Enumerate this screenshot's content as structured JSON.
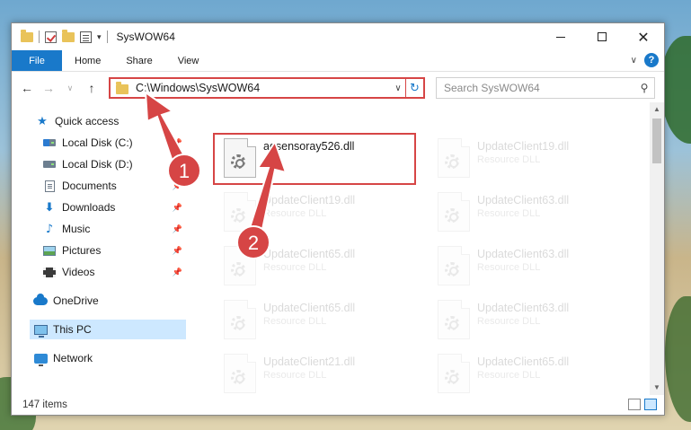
{
  "window": {
    "title": "SysWOW64"
  },
  "ribbon": {
    "tabs": [
      "File",
      "Home",
      "Share",
      "View"
    ],
    "help_label": "?"
  },
  "address": {
    "path": "C:\\Windows\\SysWOW64"
  },
  "search": {
    "placeholder": "Search SysWOW64"
  },
  "sidebar": {
    "items": [
      {
        "label": "Quick access",
        "icon": "star-icon"
      },
      {
        "label": "Local Disk (C:)",
        "icon": "disk-icon",
        "pinned": true
      },
      {
        "label": "Local Disk (D:)",
        "icon": "disk-icon"
      },
      {
        "label": "Documents",
        "icon": "documents-icon",
        "pinned": true
      },
      {
        "label": "Downloads",
        "icon": "downloads-icon",
        "pinned": true
      },
      {
        "label": "Music",
        "icon": "music-icon",
        "pinned": true
      },
      {
        "label": "Pictures",
        "icon": "pictures-icon",
        "pinned": true
      },
      {
        "label": "Videos",
        "icon": "videos-icon",
        "pinned": true
      },
      {
        "label": "OneDrive",
        "icon": "onedrive-icon"
      },
      {
        "label": "This PC",
        "icon": "this-pc-icon",
        "selected": true
      },
      {
        "label": "Network",
        "icon": "network-icon"
      }
    ]
  },
  "files": [
    {
      "name": "adsensoray526.dll",
      "type": "",
      "highlighted": true
    },
    {
      "name": "UpdateClient19.dll",
      "type": "Resource DLL"
    },
    {
      "name": "UpdateClient19.dll",
      "type": "Resource DLL"
    },
    {
      "name": "UpdateClient63.dll",
      "type": "Resource DLL"
    },
    {
      "name": "UpdateClient65.dll",
      "type": "Resource DLL"
    },
    {
      "name": "UpdateClient63.dll",
      "type": "Resource DLL"
    },
    {
      "name": "UpdateClient65.dll",
      "type": "Resource DLL"
    },
    {
      "name": "UpdateClient63.dll",
      "type": "Resource DLL"
    },
    {
      "name": "UpdateClient21.dll",
      "type": "Resource DLL"
    },
    {
      "name": "UpdateClient65.dll",
      "type": "Resource DLL"
    }
  ],
  "status": {
    "count": "147 items"
  },
  "annotations": {
    "step1": "1",
    "step2": "2",
    "color": "#d64545"
  }
}
